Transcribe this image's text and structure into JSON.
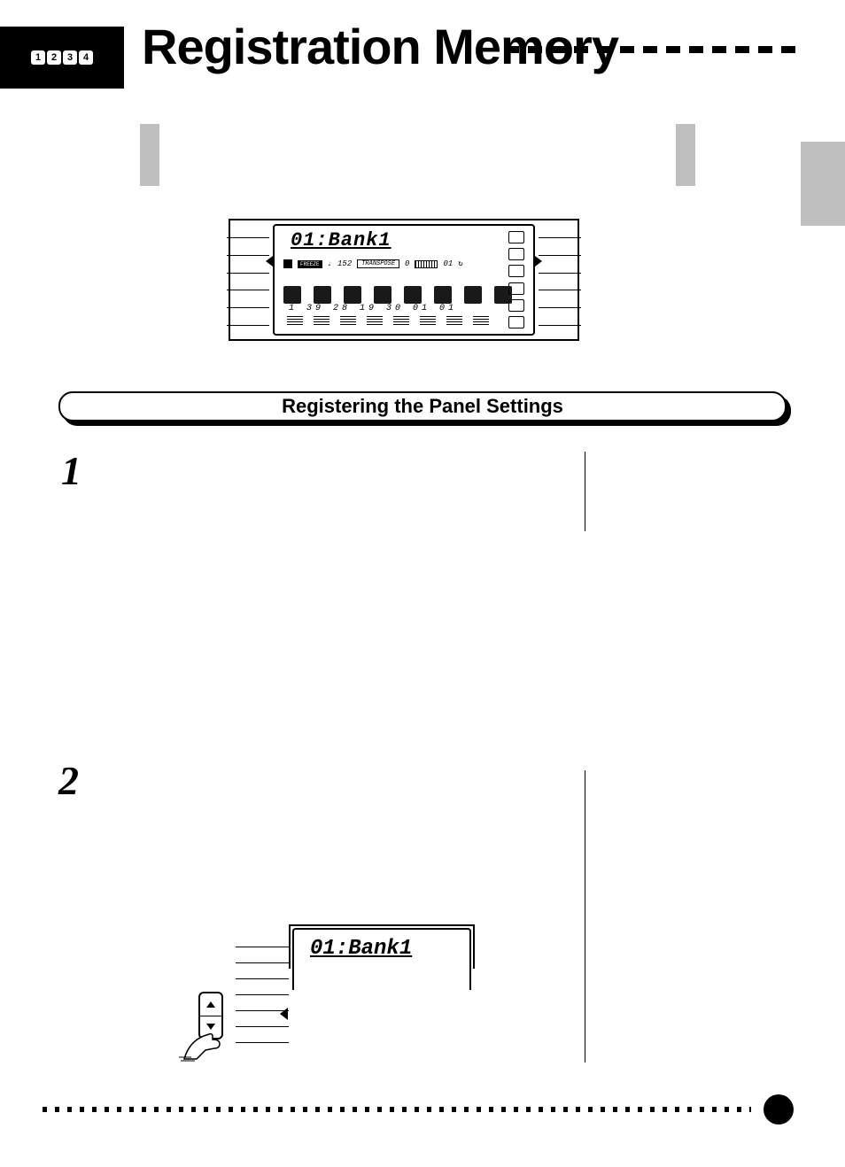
{
  "header": {
    "badges": [
      "1",
      "2",
      "3",
      "4"
    ],
    "title": "Registration Memory"
  },
  "lcd_main": {
    "top_text": "01:Bank1",
    "row2": {
      "freeze": "FREEZE",
      "tempo": "152",
      "transpose": "0",
      "measure": "01"
    },
    "track_nums": "1  39 28  19 30     01 01"
  },
  "section_heading": "Registering the Panel Settings",
  "steps": {
    "one": "1",
    "two": "2"
  },
  "lcd_step2": {
    "text": "01:Bank1"
  }
}
